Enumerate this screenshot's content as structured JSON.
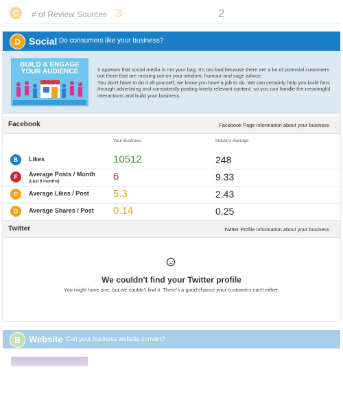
{
  "top_row": {
    "grade": "C",
    "label": "# of Review Sources",
    "yours": "3",
    "industry": "2"
  },
  "social": {
    "grade": "D",
    "title": "Social",
    "subtitle": "Do consumers like your business?",
    "banner": {
      "line1": "BUILD & ENGAGE",
      "line2": "YOUR AUDIENCE"
    },
    "intro": [
      "It appears that social media is not your bag. It's too bad because there are a lot of potential customers out there that are missing out on your wisdom, humour and sage advice.",
      "You don't have to do it all yourself, we know you have a job to do. We can certainly help you build fans through advertising and consistently posting timely relevant content, so you can handle the meaningful interactions and build your business."
    ],
    "facebook": {
      "title": "Facebook",
      "info": "Facebook Page information about your business",
      "col_yours": "Your Business",
      "col_avg": "Industry Average",
      "rows": [
        {
          "grade": "B",
          "label": "Likes",
          "sub": "",
          "yours": "10512",
          "avg": "248"
        },
        {
          "grade": "F",
          "label": "Average Posts / Month",
          "sub": "(Last 6 months)",
          "yours": "6",
          "avg": "9.33"
        },
        {
          "grade": "C",
          "label": "Average Likes / Post",
          "sub": "",
          "yours": "5.3",
          "avg": "2.43"
        },
        {
          "grade": "D",
          "label": "Average Shares / Post",
          "sub": "",
          "yours": "0.14",
          "avg": "0.25"
        }
      ]
    },
    "twitter": {
      "title": "Twitter",
      "info": "Twitter Profile information about your business",
      "icon": "sad-face-icon",
      "empty_title": "We couldn't find your Twitter profile",
      "empty_text": "You might have one, but we couldn't find it. There's a good chance your customers can't either."
    }
  },
  "website": {
    "grade": "B",
    "title": "Website",
    "subtitle": "Can your business website convert?"
  },
  "colors": {
    "header_blue": "#1a7fc7",
    "grade_b": "#6db33f",
    "grade_f": "#c8272c",
    "grade_c": "#f0a21b",
    "grade_d": "#f0a21b",
    "value_green": "#3a9a2a",
    "value_red": "#c8272c",
    "value_orange": "#f0a21b"
  }
}
